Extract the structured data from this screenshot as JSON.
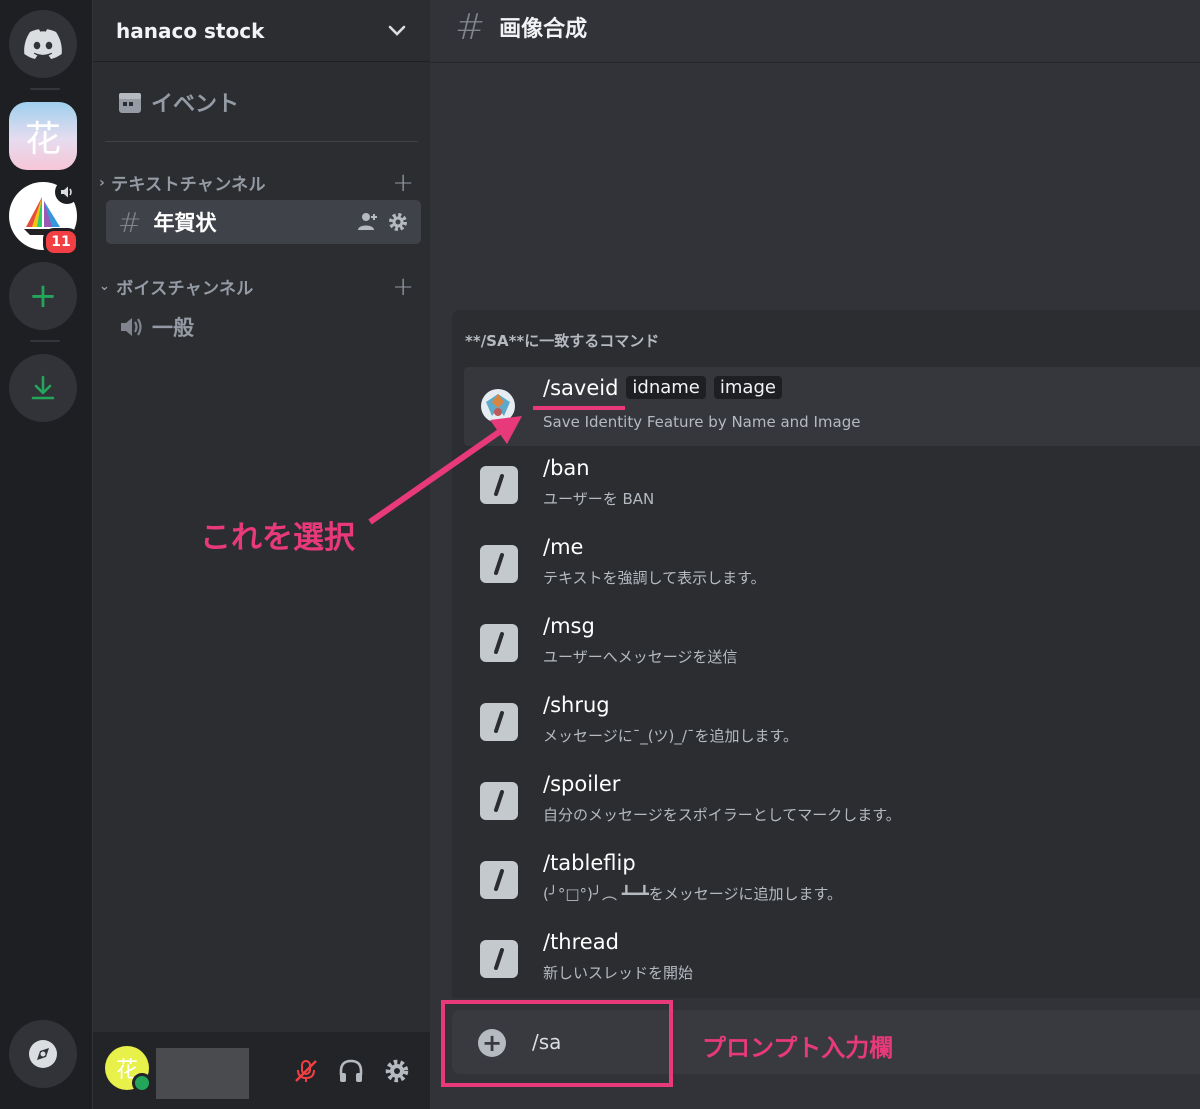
{
  "server_rail": {
    "home": "discord-logo",
    "servers": [
      {
        "name": "hanaco-server",
        "glyph": "花"
      },
      {
        "name": "sailboat-server",
        "badge": "11"
      }
    ],
    "add_server": "+",
    "download": "download-icon",
    "discover": "compass-icon"
  },
  "guild": {
    "name": "hanaco stock",
    "events_label": "イベント",
    "text_category": "テキストチャンネル",
    "text_channels": [
      {
        "name": "年賀状"
      }
    ],
    "voice_category": "ボイスチャンネル",
    "voice_channels": [
      {
        "name": "一般"
      }
    ]
  },
  "user_panel": {
    "avatar_glyph": "花",
    "status": "online"
  },
  "channel": {
    "name": "画像合成"
  },
  "autocomplete": {
    "header": "**/SA**に一致するコマンド",
    "commands": [
      {
        "name": "/saveid",
        "desc": "Save Identity Feature by Name and Image",
        "options": [
          "idname",
          "image"
        ],
        "selected": true
      },
      {
        "name": "/ban",
        "desc": "ユーザーを BAN"
      },
      {
        "name": "/me",
        "desc": "テキストを強調して表示します。"
      },
      {
        "name": "/msg",
        "desc": "ユーザーへメッセージを送信"
      },
      {
        "name": "/shrug",
        "desc": "メッセージに¯_(ツ)_/¯を追加します。"
      },
      {
        "name": "/spoiler",
        "desc": "自分のメッセージをスポイラーとしてマークします。"
      },
      {
        "name": "/tableflip",
        "desc": "(╯°□°)╯︵ ┻━┻をメッセージに追加します。"
      },
      {
        "name": "/thread",
        "desc": "新しいスレッドを開始"
      }
    ]
  },
  "input": {
    "value": "/sa"
  },
  "annotations": {
    "select_this": "これを選択",
    "prompt_field": "プロンプト入力欄",
    "accent": "#e8397a"
  },
  "colors": {
    "rail_bg": "#1e1f22",
    "sidebar_bg": "#2b2d31",
    "main_bg": "#313338",
    "green": "#23a55a",
    "danger": "#f23f43"
  }
}
